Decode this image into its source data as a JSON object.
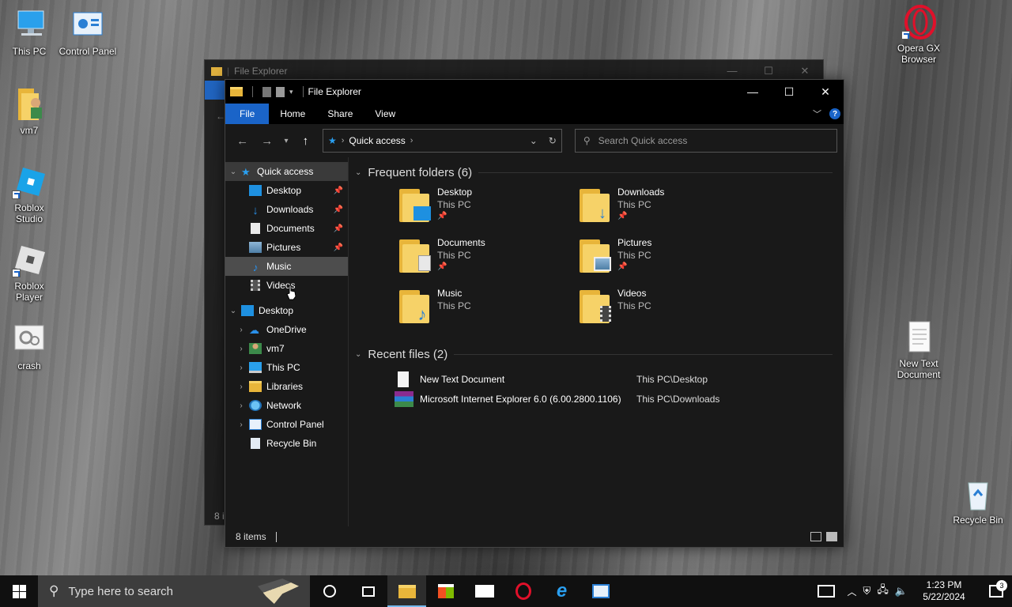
{
  "desktop": {
    "icons": [
      {
        "label": "This PC",
        "icon": "this-pc-icon"
      },
      {
        "label": "Control Panel",
        "icon": "control-panel-icon"
      },
      {
        "label": "vm7",
        "icon": "user-folder-icon"
      },
      {
        "label": "Roblox Studio",
        "icon": "roblox-studio-icon"
      },
      {
        "label": "Roblox Player",
        "icon": "roblox-player-icon"
      },
      {
        "label": "crash",
        "icon": "crash-icon"
      },
      {
        "label": "Opera GX Browser",
        "icon": "opera-gx-icon"
      },
      {
        "label": "New Text Document",
        "icon": "text-document-icon"
      },
      {
        "label": "Recycle Bin",
        "icon": "recycle-bin-icon"
      }
    ]
  },
  "back_window": {
    "title": "File Explorer",
    "status_fragment": "8 i"
  },
  "window": {
    "title": "File Explorer",
    "ribbon_tabs": [
      "File",
      "Home",
      "Share",
      "View"
    ],
    "address": {
      "location": "Quick access"
    },
    "search": {
      "placeholder": "Search Quick access"
    },
    "nav_pane": {
      "quick_access": "Quick access",
      "pinned": [
        {
          "label": "Desktop",
          "icon": "desktop-icon",
          "pinned": true
        },
        {
          "label": "Downloads",
          "icon": "downloads-icon",
          "pinned": true
        },
        {
          "label": "Documents",
          "icon": "documents-icon",
          "pinned": true
        },
        {
          "label": "Pictures",
          "icon": "pictures-icon",
          "pinned": true
        },
        {
          "label": "Music",
          "icon": "music-icon",
          "pinned": false
        },
        {
          "label": "Videos",
          "icon": "videos-icon",
          "pinned": false
        }
      ],
      "desktop_root": "Desktop",
      "tree": [
        {
          "label": "OneDrive",
          "icon": "onedrive-icon"
        },
        {
          "label": "vm7",
          "icon": "user-icon"
        },
        {
          "label": "This PC",
          "icon": "this-pc-icon"
        },
        {
          "label": "Libraries",
          "icon": "libraries-icon"
        },
        {
          "label": "Network",
          "icon": "network-icon"
        },
        {
          "label": "Control Panel",
          "icon": "control-panel-icon"
        },
        {
          "label": "Recycle Bin",
          "icon": "recycle-bin-icon"
        }
      ]
    },
    "frequent": {
      "heading": "Frequent folders (6)",
      "items": [
        {
          "name": "Desktop",
          "location": "This PC",
          "pinned": true,
          "badge_color": "#1e90e0"
        },
        {
          "name": "Downloads",
          "location": "This PC",
          "pinned": true,
          "badge_color": "#2a7fd4"
        },
        {
          "name": "Documents",
          "location": "This PC",
          "pinned": true,
          "badge_color": "#e8e8e8"
        },
        {
          "name": "Pictures",
          "location": "This PC",
          "pinned": true,
          "badge_color": "#8fb6d6"
        },
        {
          "name": "Music",
          "location": "This PC",
          "pinned": false,
          "badge_color": "#2a7fd4"
        },
        {
          "name": "Videos",
          "location": "This PC",
          "pinned": false,
          "badge_color": "#444444"
        }
      ]
    },
    "recent": {
      "heading": "Recent files (2)",
      "items": [
        {
          "name": "New Text Document",
          "path": "This PC\\Desktop",
          "icon": "text-file-icon"
        },
        {
          "name": "Microsoft Internet Explorer 6.0 (6.00.2800.1106)",
          "path": "This PC\\Downloads",
          "icon": "winrar-archive-icon"
        }
      ]
    },
    "status": {
      "items": "8 items"
    }
  },
  "taskbar": {
    "search_placeholder": "Type here to search",
    "apps": [
      "cortana-icon",
      "task-view-icon",
      "file-explorer-icon",
      "store-icon",
      "mail-icon",
      "opera-icon",
      "internet-explorer-icon",
      "control-panel-icon"
    ],
    "clock_time": "1:23 PM",
    "clock_date": "5/22/2024",
    "notification_count": "3"
  }
}
